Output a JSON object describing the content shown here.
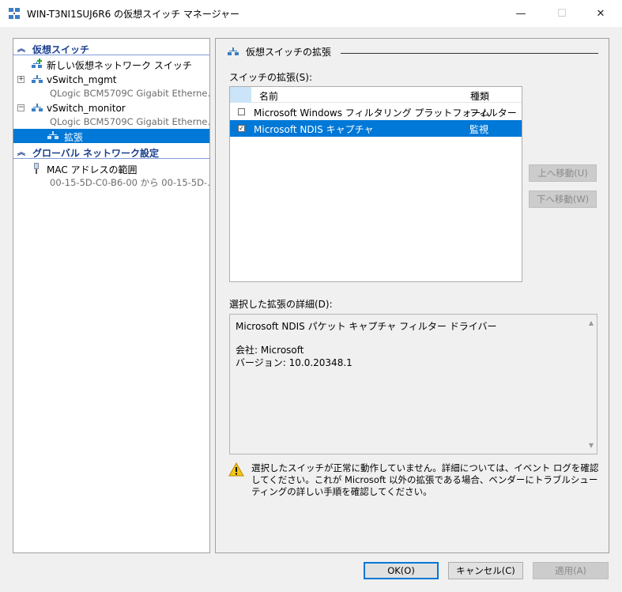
{
  "window": {
    "title": "WIN-T3NI1SUJ6R6 の仮想スイッチ マネージャー",
    "minimize": "—",
    "maximize": "☐",
    "close": "✕"
  },
  "tree": {
    "section1": "仮想スイッチ",
    "new_switch": "新しい仮想ネットワーク スイッチ",
    "switches": [
      {
        "name": "vSwitch_mgmt",
        "adapter": "QLogic BCM5709C Gigabit Etherne...",
        "expander": "+"
      },
      {
        "name": "vSwitch_monitor",
        "adapter": "QLogic BCM5709C Gigabit Etherne...",
        "expander": "−"
      }
    ],
    "extension_item": "拡張",
    "section2": "グローバル ネットワーク設定",
    "mac_range": "MAC アドレスの範囲",
    "mac_range_value": "00-15-5D-C0-B6-00 から 00-15-5D-..."
  },
  "right": {
    "group_title": "仮想スイッチの拡張",
    "list_label": "スイッチの拡張(S):",
    "columns": {
      "name": "名前",
      "type": "種類"
    },
    "rows": [
      {
        "name": "Microsoft Windows フィルタリング プラットフォーム",
        "type": "フィルター",
        "checked": ""
      },
      {
        "name": "Microsoft NDIS キャプチャ",
        "type": "監視",
        "checked": "✓"
      }
    ],
    "move_up": "上へ移動(U)",
    "move_down": "下へ移動(W)",
    "details_label": "選択した拡張の詳細(D):",
    "details": {
      "description": "Microsoft NDIS パケット キャプチャ フィルター ドライバー",
      "company": "会社: Microsoft",
      "version": "バージョン: 10.0.20348.1"
    },
    "warning": "選択したスイッチが正常に動作していません。詳細については、イベント ログを確認してください。これが Microsoft 以外の拡張である場合、ベンダーにトラブルシューティングの詳しい手順を確認してください。"
  },
  "footer": {
    "ok": "OK(O)",
    "cancel": "キャンセル(C)",
    "apply": "適用(A)"
  },
  "colors": {
    "selection": "#0078d7",
    "section_header": "#1a3e8e"
  }
}
